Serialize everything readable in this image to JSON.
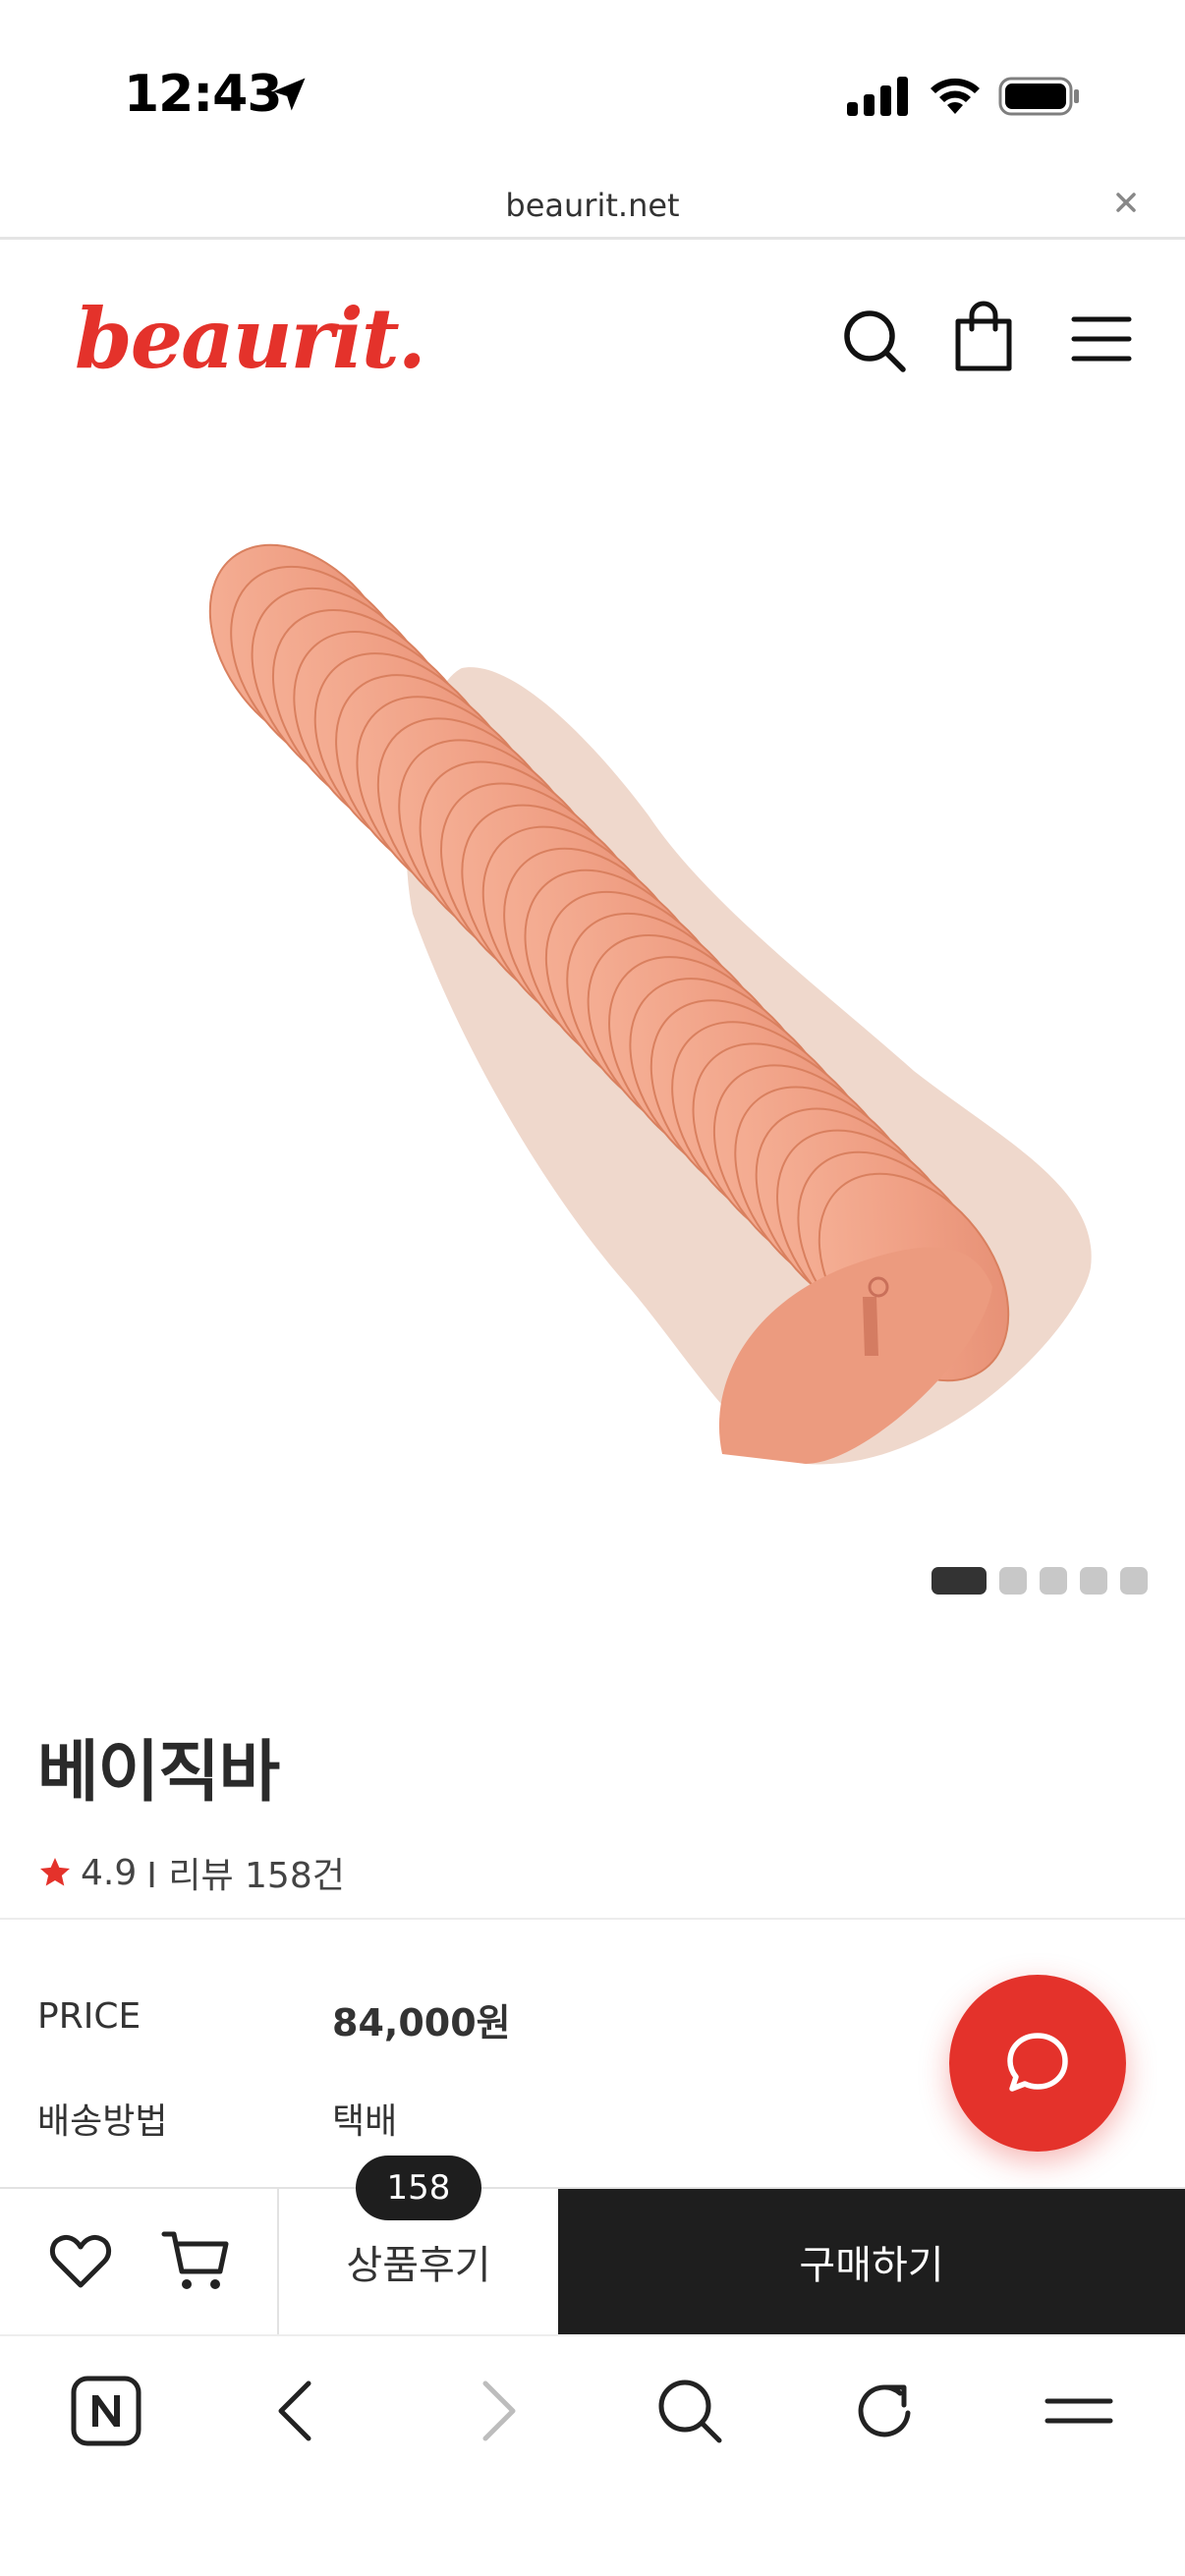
{
  "status_bar": {
    "time": "12:43",
    "icons": [
      "location-arrow-icon",
      "cellular-signal-icon",
      "wifi-icon",
      "battery-icon"
    ]
  },
  "browser": {
    "url": "beaurit.net",
    "close_icon": "close-icon"
  },
  "header": {
    "logo": "beaurit.",
    "brand_color": "#e4322b",
    "icons": [
      "search-icon",
      "shopping-bag-icon",
      "hamburger-menu-icon"
    ]
  },
  "carousel": {
    "total": 5,
    "active_index": 0
  },
  "product": {
    "title": "베이직바",
    "rating": "4.9",
    "review_text": "I 리뷰 158건",
    "price_label": "PRICE",
    "price_value": "84,000원",
    "shipping_label": "배송방법",
    "shipping_value": "택배"
  },
  "purchase_bar": {
    "review_count": "158",
    "review_label": "상품후기",
    "buy_label": "구매하기",
    "icons": [
      "heart-icon",
      "cart-icon"
    ]
  },
  "chat_fab": {
    "icon": "chat-bubble-icon",
    "color": "#e4322b"
  },
  "browser_toolbar": {
    "icons": [
      "naver-home-icon",
      "back-icon",
      "forward-icon",
      "search-icon",
      "reload-icon",
      "menu-icon"
    ]
  }
}
